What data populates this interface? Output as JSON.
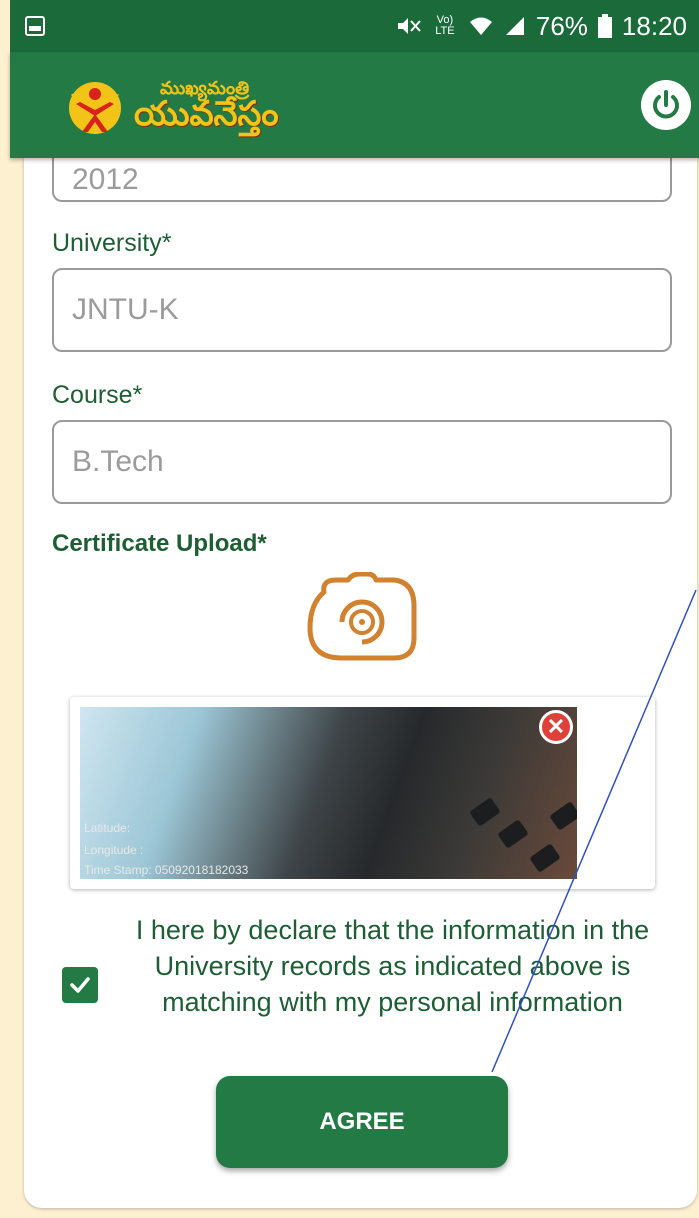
{
  "status_bar": {
    "signal_label": "Vo) LTE",
    "battery_percent": "76%",
    "time": "18:20"
  },
  "app_bar": {
    "logo_line1": "ముఖ్యమంత్రి",
    "logo_line2": "యువనేస్తం"
  },
  "form": {
    "year_value": "2012",
    "university_label": "University*",
    "university_value": "JNTU-K",
    "course_label": "Course*",
    "course_value": "B.Tech",
    "certificate_label": "Certificate Upload*"
  },
  "photo": {
    "latitude": "Latitude:",
    "longitude": "Longitude :",
    "timestamp": "Time Stamp: 05092018182033"
  },
  "declaration": {
    "checked": true,
    "text": "I here by declare that the information in the University records as indicated above is matching with my personal information"
  },
  "agree_button": "AGREE",
  "colors": {
    "primary": "#237a44",
    "label_text": "#1d5e34",
    "accent_orange": "#d2822f",
    "logo_yellow": "#f3c418",
    "background": "#fdf0d0",
    "annotation_line": "#2f50c8"
  }
}
